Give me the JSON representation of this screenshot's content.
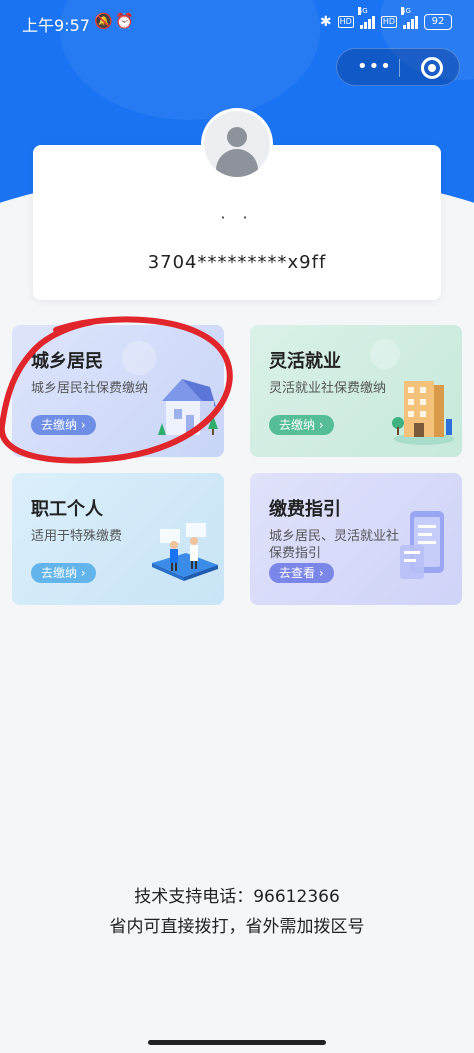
{
  "status_bar": {
    "time": "上午9:57",
    "network_label": "4G",
    "hd_label": "HD",
    "battery": "92"
  },
  "user": {
    "name": "·  ·",
    "id_masked": "3704*********x9ff"
  },
  "services": [
    {
      "title": "城乡居民",
      "subtitle": "城乡居民社保费缴纳",
      "button": "去缴纳 ›",
      "icon": "house-illustration"
    },
    {
      "title": "灵活就业",
      "subtitle": "灵活就业社保费缴纳",
      "button": "去缴纳 ›",
      "icon": "building-illustration"
    },
    {
      "title": "职工个人",
      "subtitle": "适用于特殊缴费",
      "button": "去缴纳 ›",
      "icon": "workers-illustration"
    },
    {
      "title": "缴费指引",
      "subtitle": "城乡居民、灵活就业社保费指引",
      "button": "去查看 ›",
      "icon": "phone-guide-illustration"
    }
  ],
  "footer": {
    "hotline": "技术支持电话：96612366",
    "note": "省内可直接拨打，省外需加拨区号"
  },
  "colors": {
    "primary_blue": "#1a73f2",
    "annotation_red": "#e0262b"
  }
}
